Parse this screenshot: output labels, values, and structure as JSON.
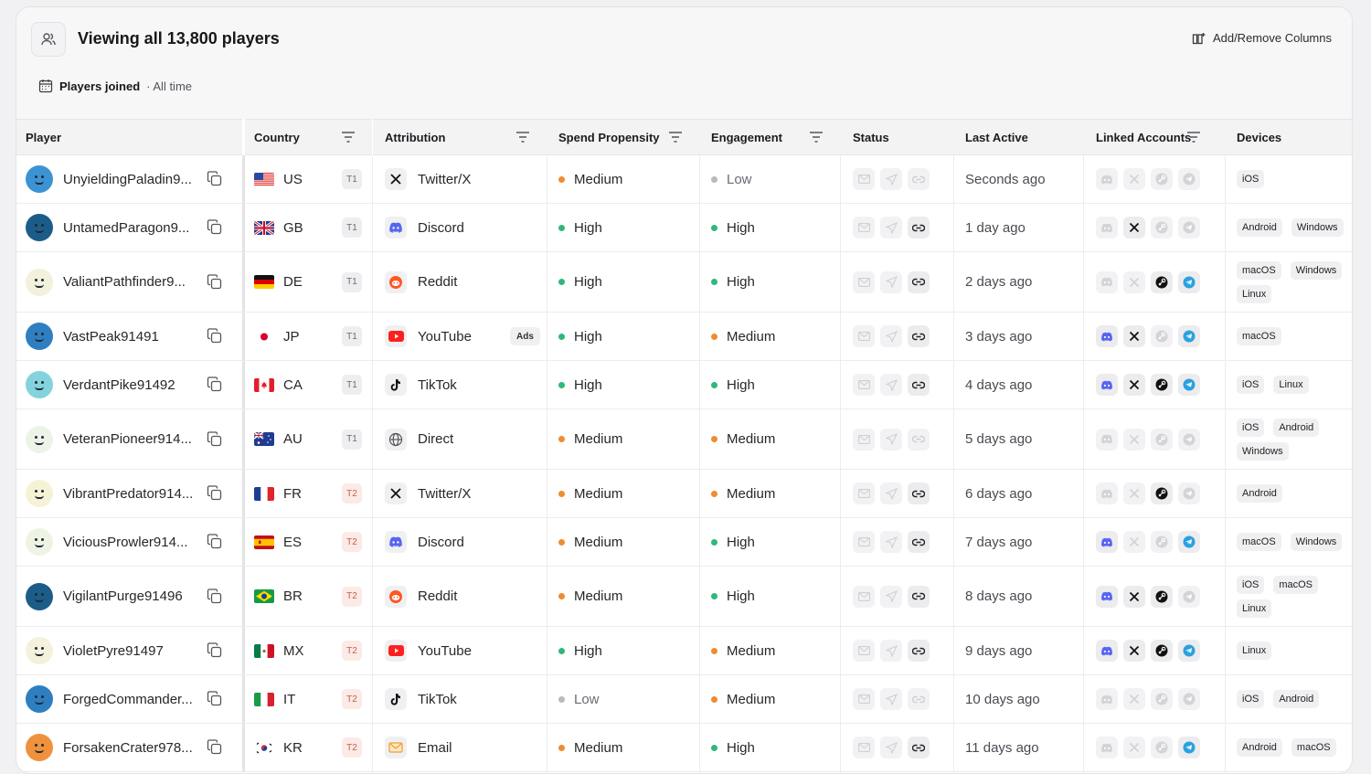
{
  "header": {
    "title": "Viewing all 13,800 players",
    "columns_button": "Add/Remove Columns",
    "filter_label": "Players joined",
    "filter_value": "· All time"
  },
  "columns": {
    "player": "Player",
    "country": "Country",
    "attribution": "Attribution",
    "spend": "Spend Propensity",
    "engagement": "Engagement",
    "status": "Status",
    "last_active": "Last Active",
    "linked": "Linked Accounts",
    "devices": "Devices"
  },
  "colors": {
    "high": "#2fb87a",
    "medium": "#f08b2f",
    "low": "#b9b9bf",
    "discord": "#5865f2",
    "telegram": "#2aa1e0",
    "reddit": "#ff5722",
    "youtube": "#ff1f1f"
  },
  "rows": [
    {
      "name": "UnyieldingPaladin9...",
      "avatar": "#3b93d3",
      "country": "US",
      "flag": "us",
      "tier": "T1",
      "source": "Twitter/X",
      "src_icon": "x",
      "ads": "",
      "spend": "Medium",
      "engagement": "Low",
      "status": [
        0,
        0,
        0
      ],
      "last": "Seconds ago",
      "linked": [
        0,
        0,
        0,
        0
      ],
      "devices": [
        "iOS"
      ]
    },
    {
      "name": "UntamedParagon9...",
      "avatar": "#1b5d88",
      "country": "GB",
      "flag": "gb",
      "tier": "T1",
      "source": "Discord",
      "src_icon": "discord",
      "ads": "",
      "spend": "High",
      "engagement": "High",
      "status": [
        0,
        0,
        1
      ],
      "last": "1 day ago",
      "linked": [
        0,
        1,
        0,
        0
      ],
      "devices": [
        "Android",
        "Windows"
      ]
    },
    {
      "name": "ValiantPathfinder9...",
      "avatar": "#f2f1dc",
      "country": "DE",
      "flag": "de",
      "tier": "T1",
      "source": "Reddit",
      "src_icon": "reddit",
      "ads": "",
      "spend": "High",
      "engagement": "High",
      "status": [
        0,
        0,
        1
      ],
      "last": "2 days ago",
      "linked": [
        0,
        0,
        1,
        1
      ],
      "devices": [
        "macOS",
        "Windows",
        "Linux"
      ]
    },
    {
      "name": "VastPeak91491",
      "avatar": "#2f7fc0",
      "country": "JP",
      "flag": "jp",
      "tier": "T1",
      "source": "YouTube",
      "src_icon": "youtube",
      "ads": "Ads",
      "spend": "High",
      "engagement": "Medium",
      "status": [
        0,
        0,
        1
      ],
      "last": "3 days ago",
      "linked": [
        1,
        1,
        0,
        1
      ],
      "devices": [
        "macOS"
      ]
    },
    {
      "name": "VerdantPike91492",
      "avatar": "#84d3dc",
      "country": "CA",
      "flag": "ca",
      "tier": "T1",
      "source": "TikTok",
      "src_icon": "tiktok",
      "ads": "",
      "spend": "High",
      "engagement": "High",
      "status": [
        0,
        0,
        1
      ],
      "last": "4 days ago",
      "linked": [
        1,
        1,
        1,
        1
      ],
      "devices": [
        "iOS",
        "Linux"
      ]
    },
    {
      "name": "VeteranPioneer914...",
      "avatar": "#eef3e8",
      "country": "AU",
      "flag": "au",
      "tier": "T1",
      "source": "Direct",
      "src_icon": "globe",
      "ads": "",
      "spend": "Medium",
      "engagement": "Medium",
      "status": [
        0,
        0,
        0
      ],
      "last": "5 days ago",
      "linked": [
        0,
        0,
        0,
        0
      ],
      "devices": [
        "iOS",
        "Android",
        "Windows"
      ]
    },
    {
      "name": "VibrantPredator914...",
      "avatar": "#f6f2d6",
      "country": "FR",
      "flag": "fr",
      "tier": "T2",
      "source": "Twitter/X",
      "src_icon": "x",
      "ads": "",
      "spend": "Medium",
      "engagement": "Medium",
      "status": [
        0,
        0,
        1
      ],
      "last": "6 days ago",
      "linked": [
        0,
        0,
        1,
        0
      ],
      "devices": [
        "Android"
      ]
    },
    {
      "name": "ViciousProwler914...",
      "avatar": "#eef4e4",
      "country": "ES",
      "flag": "es",
      "tier": "T2",
      "source": "Discord",
      "src_icon": "discord",
      "ads": "",
      "spend": "Medium",
      "engagement": "High",
      "status": [
        0,
        0,
        1
      ],
      "last": "7 days ago",
      "linked": [
        1,
        0,
        0,
        1
      ],
      "devices": [
        "macOS",
        "Windows"
      ]
    },
    {
      "name": "VigilantPurge91496",
      "avatar": "#1b5d88",
      "country": "BR",
      "flag": "br",
      "tier": "T2",
      "source": "Reddit",
      "src_icon": "reddit",
      "ads": "",
      "spend": "Medium",
      "engagement": "High",
      "status": [
        0,
        0,
        1
      ],
      "last": "8 days ago",
      "linked": [
        1,
        1,
        1,
        0
      ],
      "devices": [
        "iOS",
        "macOS",
        "Linux"
      ]
    },
    {
      "name": "VioletPyre91497",
      "avatar": "#f4f1dc",
      "country": "MX",
      "flag": "mx",
      "tier": "T2",
      "source": "YouTube",
      "src_icon": "youtube",
      "ads": "",
      "spend": "High",
      "engagement": "Medium",
      "status": [
        0,
        0,
        1
      ],
      "last": "9 days ago",
      "linked": [
        1,
        1,
        1,
        1
      ],
      "devices": [
        "Linux"
      ]
    },
    {
      "name": "ForgedCommander...",
      "avatar": "#2f7fc0",
      "country": "IT",
      "flag": "it",
      "tier": "T2",
      "source": "TikTok",
      "src_icon": "tiktok",
      "ads": "",
      "spend": "Low",
      "engagement": "Medium",
      "status": [
        0,
        0,
        0
      ],
      "last": "10 days ago",
      "linked": [
        0,
        0,
        0,
        0
      ],
      "devices": [
        "iOS",
        "Android"
      ]
    },
    {
      "name": "ForsakenCrater978...",
      "avatar": "#f0913e",
      "country": "KR",
      "flag": "kr",
      "tier": "T2",
      "source": "Email",
      "src_icon": "mail",
      "ads": "",
      "spend": "Medium",
      "engagement": "High",
      "status": [
        0,
        0,
        1
      ],
      "last": "11 days ago",
      "linked": [
        0,
        0,
        0,
        1
      ],
      "devices": [
        "Android",
        "macOS"
      ]
    }
  ]
}
